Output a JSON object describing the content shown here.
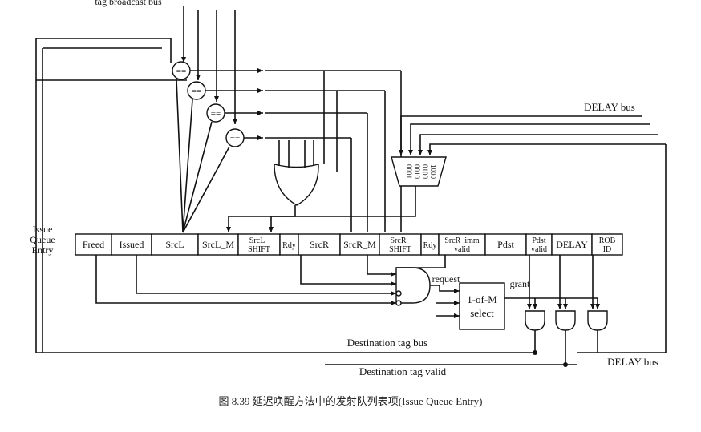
{
  "title_top": "tag broadcast bus",
  "delay_bus_label": "DELAY bus",
  "delay_bus_bottom_label": "DELAY bus",
  "entry_label": [
    "Issue",
    "Queue",
    "Entry"
  ],
  "fields": [
    {
      "id": "freed",
      "l1": "Freed",
      "l2": ""
    },
    {
      "id": "issued",
      "l1": "Issued",
      "l2": ""
    },
    {
      "id": "srcl",
      "l1": "SrcL",
      "l2": ""
    },
    {
      "id": "srcl_m",
      "l1": "SrcL_M",
      "l2": ""
    },
    {
      "id": "srcl_shift",
      "l1": "SrcL_",
      "l2": "SHIFT"
    },
    {
      "id": "rdy_l",
      "l1": "Rdy",
      "l2": ""
    },
    {
      "id": "srcr",
      "l1": "SrcR",
      "l2": ""
    },
    {
      "id": "srcr_m",
      "l1": "SrcR_M",
      "l2": ""
    },
    {
      "id": "srcr_shift",
      "l1": "SrcR_",
      "l2": "SHIFT"
    },
    {
      "id": "rdy_r",
      "l1": "Rdy",
      "l2": ""
    },
    {
      "id": "srcr_imm",
      "l1": "SrcR_imm",
      "l2": "valid"
    },
    {
      "id": "pdst",
      "l1": "Pdst",
      "l2": ""
    },
    {
      "id": "pdst_valid",
      "l1": "Pdst",
      "l2": "valid"
    },
    {
      "id": "delay",
      "l1": "DELAY",
      "l2": ""
    },
    {
      "id": "rob_id",
      "l1": "ROB",
      "l2": "ID"
    }
  ],
  "comparator_symbol": "==",
  "mux_inputs": [
    "0001",
    "0010",
    "0100",
    "1000"
  ],
  "request_label": "request",
  "grant_label": "grant",
  "select_label_1": "1-of-M",
  "select_label_2": "select",
  "dest_tag_bus_label": "Destination tag bus",
  "dest_tag_valid_label": "Destination tag valid",
  "caption": "图 8.39   延迟唤醒方法中的发射队列表项(Issue Queue Entry)"
}
